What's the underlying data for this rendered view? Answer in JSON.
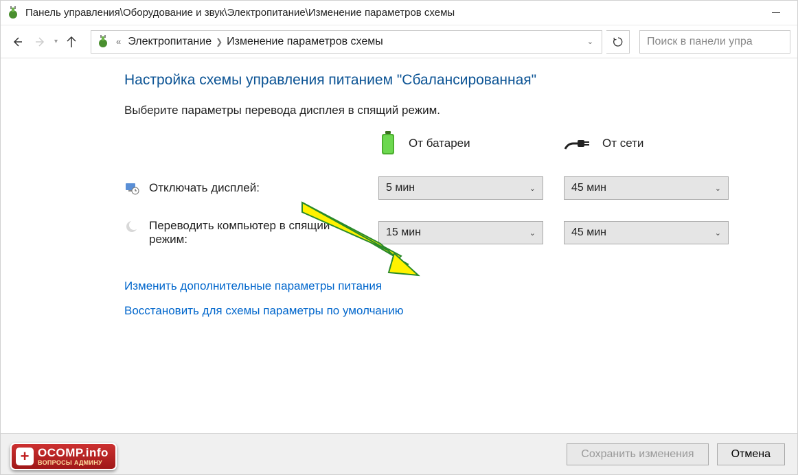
{
  "window": {
    "title": "Панель управления\\Оборудование и звук\\Электропитание\\Изменение параметров схемы"
  },
  "breadcrumb": {
    "item1": "Электропитание",
    "item2": "Изменение параметров схемы"
  },
  "search": {
    "placeholder": "Поиск в панели упра"
  },
  "page": {
    "heading": "Настройка схемы управления питанием \"Сбалансированная\"",
    "subheading": "Выберите параметры перевода дисплея в спящий режим."
  },
  "columns": {
    "battery": "От батареи",
    "plugged": "От сети"
  },
  "rows": {
    "display_off": {
      "label": "Отключать дисплей:",
      "battery_value": "5 мин",
      "plugged_value": "45 мин"
    },
    "sleep": {
      "label": "Переводить компьютер в спящий режим:",
      "battery_value": "15 мин",
      "plugged_value": "45 мин"
    }
  },
  "links": {
    "advanced": "Изменить дополнительные параметры питания",
    "restore": "Восстановить для схемы параметры по умолчанию"
  },
  "footer": {
    "save": "Сохранить изменения",
    "cancel": "Отмена"
  },
  "watermark": {
    "main": "OCOMP.info",
    "sub": "ВОПРОСЫ АДМИНУ"
  }
}
